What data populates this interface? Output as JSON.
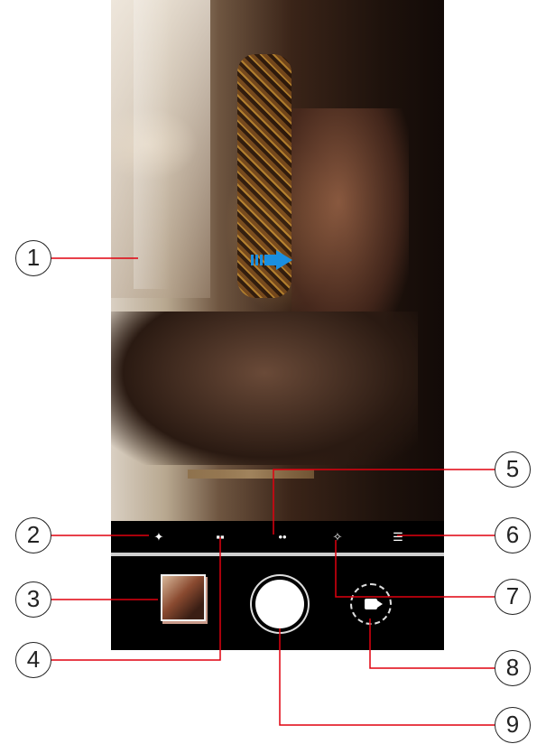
{
  "callouts": [
    "1",
    "2",
    "3",
    "4",
    "5",
    "6",
    "7",
    "8",
    "9"
  ],
  "mode_icons": [
    {
      "name": "ai-sparkle-icon"
    },
    {
      "name": "aperture-mode-icon"
    },
    {
      "name": "filter-mode-icon"
    },
    {
      "name": "flash-mode-icon"
    },
    {
      "name": "settings-mode-icon"
    }
  ],
  "colors": {
    "callout_line": "#e0000f",
    "arrow": "#1a8fe0",
    "screen_bg": "#000000"
  }
}
